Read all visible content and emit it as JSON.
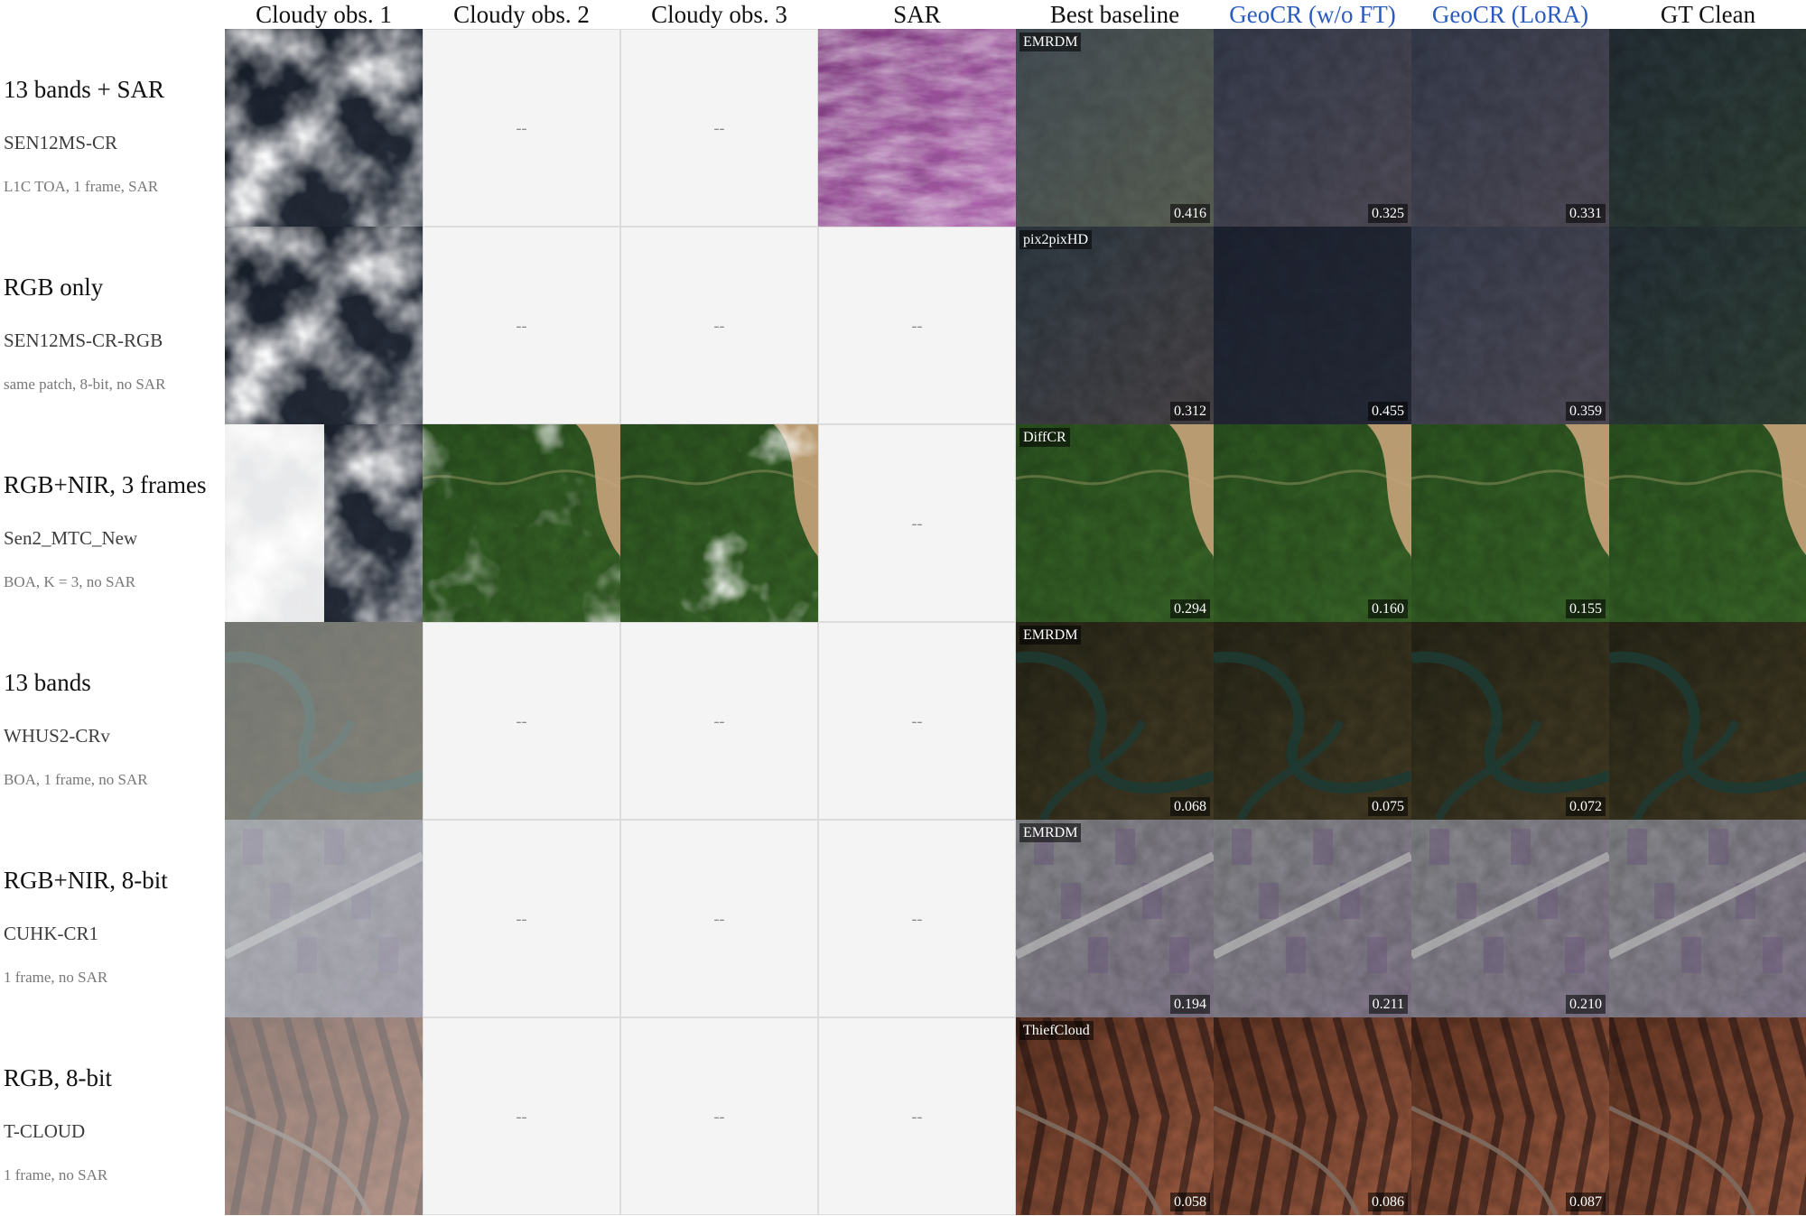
{
  "columns": [
    {
      "label": "Cloudy obs. 1"
    },
    {
      "label": "Cloudy obs. 2"
    },
    {
      "label": "Cloudy obs. 3"
    },
    {
      "label": "SAR"
    },
    {
      "label": "Best baseline"
    },
    {
      "label": "GeoCR (w/o FT)",
      "accent": true
    },
    {
      "label": "GeoCR (LoRA)",
      "accent": true
    },
    {
      "label": "GT Clean"
    }
  ],
  "placeholder": "--",
  "accent_color": "#2a5bbf",
  "rows": [
    {
      "title": "13 bands + SAR",
      "dataset": "SEN12MS-CR",
      "desc": "L1C TOA, 1 frame, SAR",
      "scene": "sen12-13",
      "baseline": "EMRDM",
      "cells": [
        "cloud-a",
        "empty",
        "empty",
        "sar",
        "b-blur",
        "b-navy",
        "b-navy",
        "b-gt"
      ],
      "metrics": {
        "baseline": "0.416",
        "wofT": "0.325",
        "lora": "0.331"
      }
    },
    {
      "title": "RGB only",
      "dataset": "SEN12MS-CR-RGB",
      "desc": "same patch, 8-bit, no SAR",
      "scene": "sen12-rgb",
      "baseline": "pix2pixHD",
      "cells": [
        "cloud-a",
        "empty",
        "empty",
        "empty",
        "b-hd",
        "b-dark",
        "b-navy",
        "b-gt"
      ],
      "metrics": {
        "baseline": "0.312",
        "wofT": "0.455",
        "lora": "0.359"
      }
    },
    {
      "title": "RGB+NIR, 3 frames",
      "dataset": "Sen2_MTC_New",
      "desc": "BOA, K = 3, no SAR",
      "scene": "sen2mtc",
      "baseline": "DiffCR",
      "cells": [
        "cloud-white",
        "green-cloud1",
        "green-cloud2",
        "empty",
        "green",
        "green",
        "green",
        "green"
      ],
      "metrics": {
        "baseline": "0.294",
        "wofT": "0.160",
        "lora": "0.155"
      }
    },
    {
      "title": "13 bands",
      "dataset": "WHUS2-CRv",
      "desc": "BOA, 1 frame, no SAR",
      "scene": "whus2",
      "baseline": "EMRDM",
      "cells": [
        "haze-olive",
        "empty",
        "empty",
        "empty",
        "olive",
        "olive",
        "olive",
        "olive"
      ],
      "metrics": {
        "baseline": "0.068",
        "wofT": "0.075",
        "lora": "0.072"
      }
    },
    {
      "title": "RGB+NIR, 8-bit",
      "dataset": "CUHK-CR1",
      "desc": "1 frame, no SAR",
      "scene": "cuhk",
      "baseline": "EMRDM",
      "cells": [
        "haze-urban",
        "empty",
        "empty",
        "empty",
        "urban",
        "urban",
        "urban",
        "urban"
      ],
      "metrics": {
        "baseline": "0.194",
        "wofT": "0.211",
        "lora": "0.210"
      }
    },
    {
      "title": "RGB, 8-bit",
      "dataset": "T-CLOUD",
      "desc": "1 frame, no SAR",
      "scene": "tcloud",
      "baseline": "ThiefCloud",
      "cells": [
        "haze-desert",
        "empty",
        "empty",
        "empty",
        "desert",
        "desert",
        "desert",
        "desert"
      ],
      "metrics": {
        "baseline": "0.058",
        "wofT": "0.086",
        "lora": "0.087"
      }
    }
  ]
}
